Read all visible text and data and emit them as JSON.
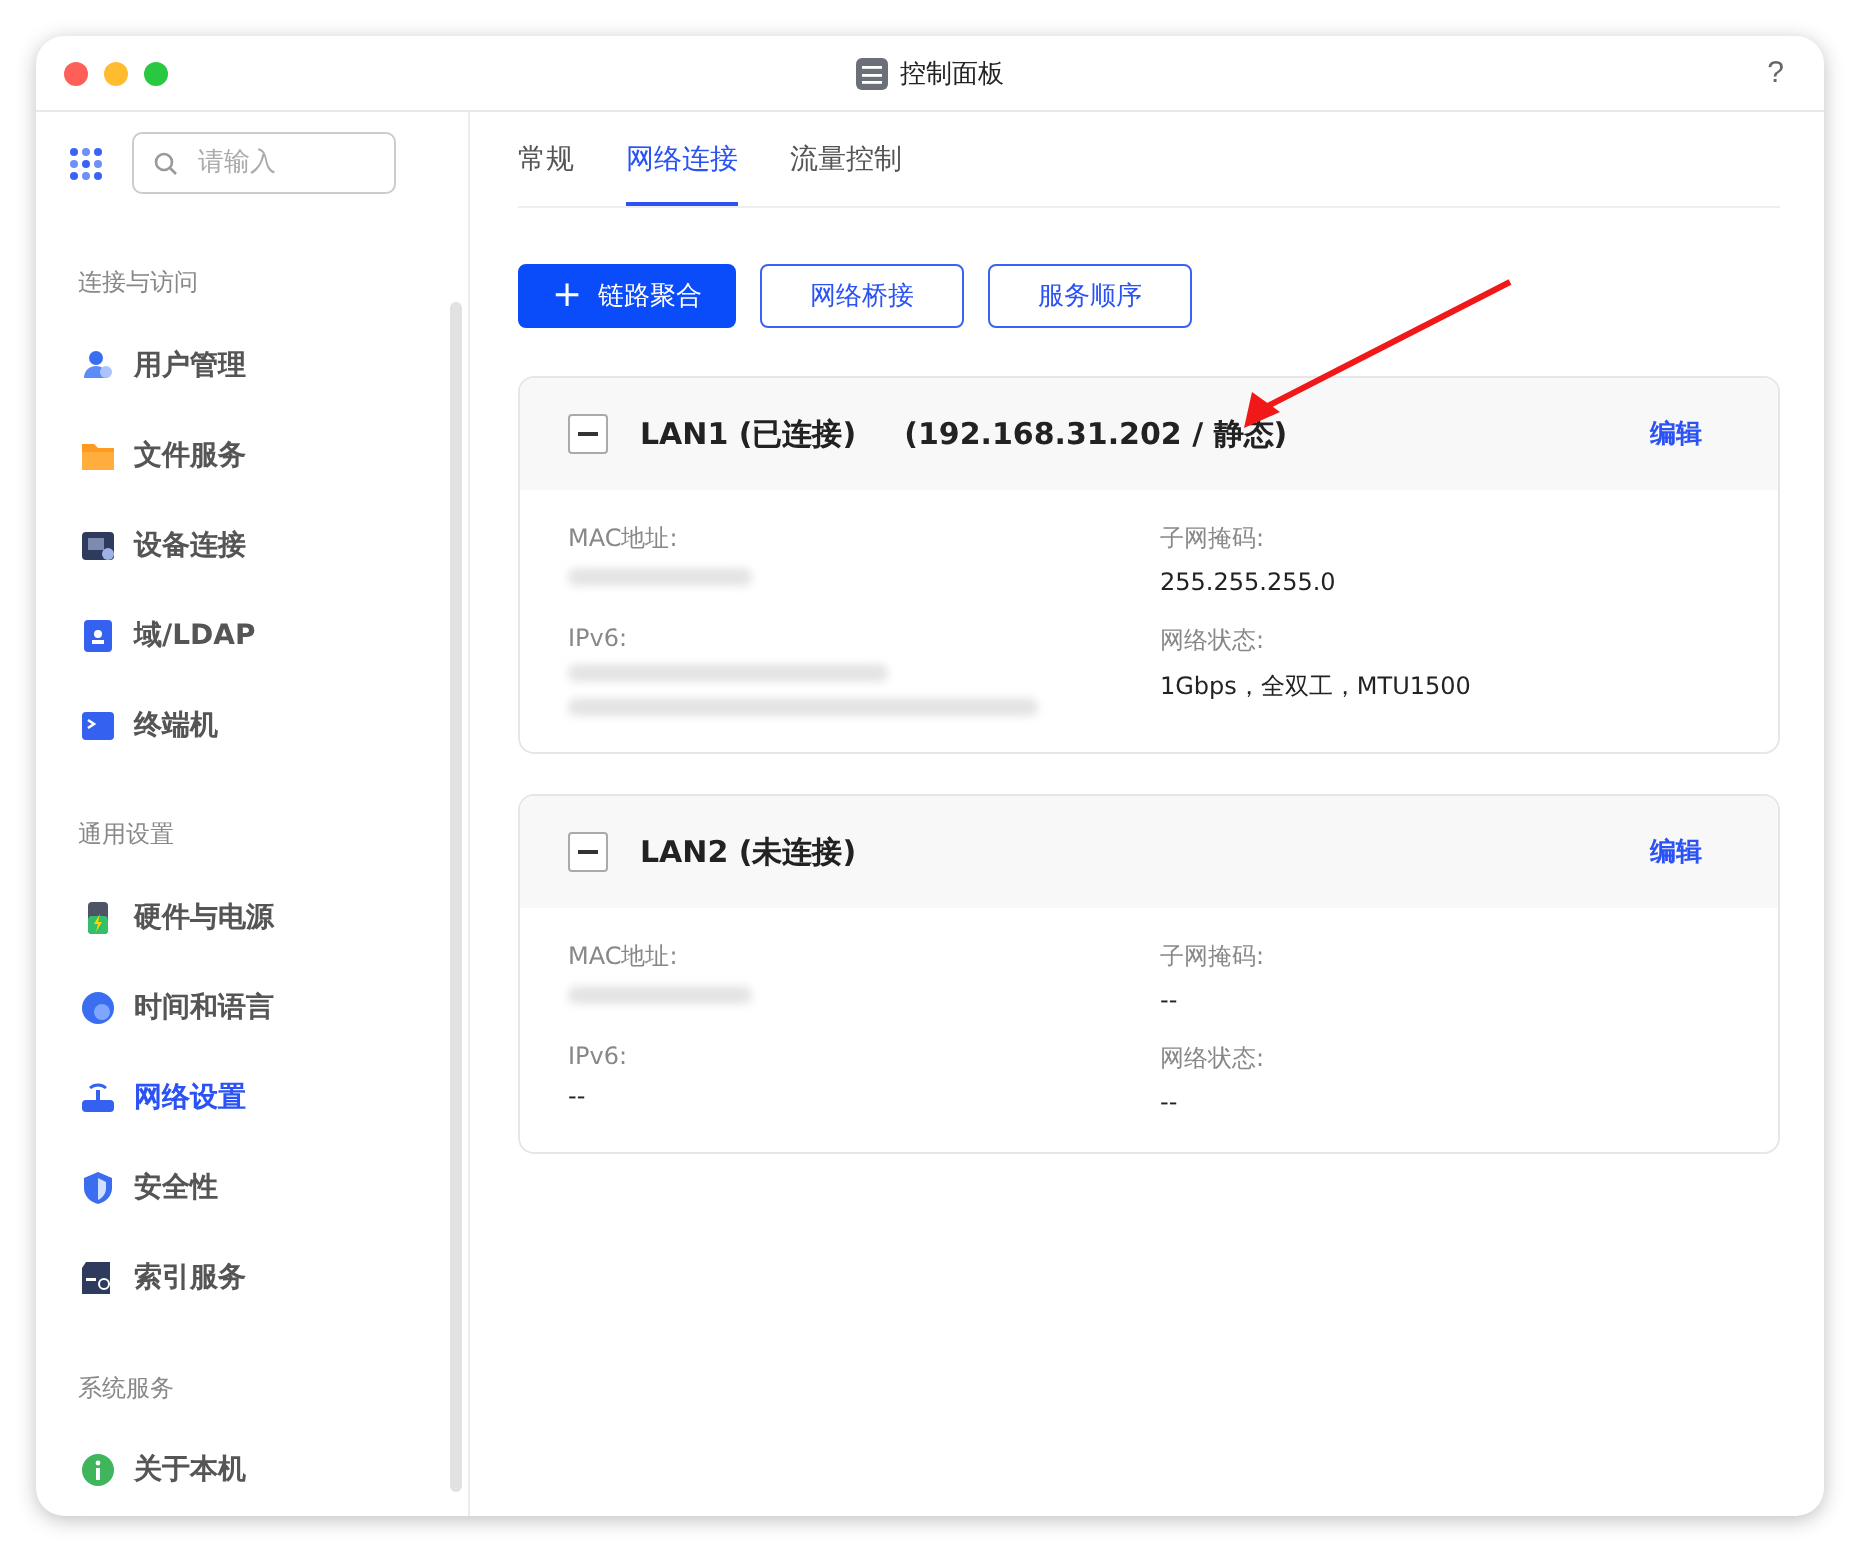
{
  "window": {
    "title": "控制面板",
    "help": "?"
  },
  "sidebar": {
    "search": {
      "placeholder": "请输入"
    },
    "groups": [
      {
        "title": "连接与访问",
        "items": [
          {
            "label": "用户管理",
            "selected": false
          },
          {
            "label": "文件服务",
            "selected": false
          },
          {
            "label": "设备连接",
            "selected": false
          },
          {
            "label": "域/LDAP",
            "selected": false
          },
          {
            "label": "终端机",
            "selected": false
          }
        ]
      },
      {
        "title": "通用设置",
        "items": [
          {
            "label": "硬件与电源",
            "selected": false
          },
          {
            "label": "时间和语言",
            "selected": false
          },
          {
            "label": "网络设置",
            "selected": true
          },
          {
            "label": "安全性",
            "selected": false
          },
          {
            "label": "索引服务",
            "selected": false
          }
        ]
      },
      {
        "title": "系统服务",
        "items": [
          {
            "label": "关于本机",
            "selected": false
          }
        ]
      }
    ]
  },
  "tabs": [
    {
      "label": "常规",
      "selected": false
    },
    {
      "label": "网络连接",
      "selected": true
    },
    {
      "label": "流量控制",
      "selected": false
    }
  ],
  "toolbar": [
    {
      "label": "链路聚合",
      "kind": "primary",
      "icon": "+"
    },
    {
      "label": "网络桥接",
      "kind": "outline"
    },
    {
      "label": "服务顺序",
      "kind": "outline"
    }
  ],
  "interfaces": [
    {
      "name": "LAN1 (已连接)",
      "address": "(192.168.31.202 / 静态)",
      "edit": "编辑",
      "expanded": true,
      "fields": [
        {
          "label": "MAC地址:",
          "kind": "redacted"
        },
        {
          "label": "子网掩码:",
          "value": "255.255.255.0"
        },
        {
          "label": "IPv6:",
          "kind": "redacted-long"
        },
        {
          "label": "网络状态:",
          "value": "1Gbps，全双工，MTU1500"
        }
      ]
    },
    {
      "name": "LAN2 (未连接)",
      "edit": "编辑",
      "expanded": true,
      "fields": [
        {
          "label": "MAC地址:",
          "kind": "redacted"
        },
        {
          "label": "子网掩码:",
          "value": "--"
        },
        {
          "label": "IPv6:",
          "value": "--"
        },
        {
          "label": "网络状态:",
          "value": "--"
        }
      ]
    }
  ]
}
